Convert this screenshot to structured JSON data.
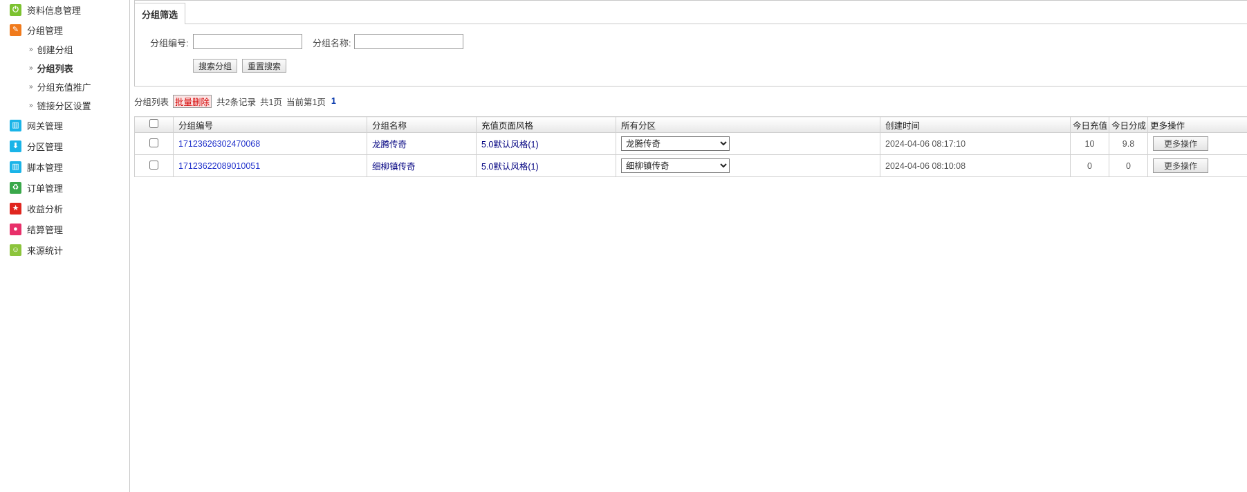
{
  "sidebar": {
    "items": [
      {
        "label": "资料信息管理",
        "icon": "power-icon",
        "color": "#7cc230",
        "glyph": "⏻"
      },
      {
        "label": "分组管理",
        "icon": "pencil-icon",
        "color": "#f07a1c",
        "glyph": "✎"
      },
      {
        "label": "网关管理",
        "icon": "grid-icon",
        "color": "#1ab4e8",
        "glyph": "▥"
      },
      {
        "label": "分区管理",
        "icon": "download-icon",
        "color": "#1ab4e8",
        "glyph": "⬇"
      },
      {
        "label": "脚本管理",
        "icon": "grid-icon",
        "color": "#1ab4e8",
        "glyph": "▥"
      },
      {
        "label": "订单管理",
        "icon": "recycle-icon",
        "color": "#3aa84a",
        "glyph": "♻"
      },
      {
        "label": "收益分析",
        "icon": "star-icon",
        "color": "#e0261f",
        "glyph": "★"
      },
      {
        "label": "结算管理",
        "icon": "record-icon",
        "color": "#e8306a",
        "glyph": "●"
      },
      {
        "label": "来源统计",
        "icon": "smile-icon",
        "color": "#8cc43c",
        "glyph": "☺"
      }
    ],
    "sub_items": [
      {
        "label": "创建分组",
        "active": false
      },
      {
        "label": "分组列表",
        "active": true
      },
      {
        "label": "分组充值推广",
        "active": false
      },
      {
        "label": "链接分区设置",
        "active": false
      }
    ],
    "arrow": "»"
  },
  "filter": {
    "tab": "分组筛选",
    "id_label": "分组编号:",
    "id_value": "",
    "name_label": "分组名称:",
    "name_value": "",
    "search_button": "搜索分组",
    "reset_button": "重置搜索"
  },
  "listbar": {
    "title": "分组列表",
    "batch_delete": "批量删除",
    "total": "共2条记录",
    "pages": "共1页",
    "current": "当前第1页",
    "page_link": "1"
  },
  "table": {
    "headers": [
      "分组编号",
      "分组名称",
      "充值页面风格",
      "所有分区",
      "创建时间",
      "今日充值",
      "今日分成",
      "更多操作"
    ],
    "rows": [
      {
        "id": "17123626302470068",
        "name": "龙腾传奇",
        "style": "5.0默认风格(1)",
        "partition": "龙腾传奇",
        "created": "2024-04-06 08:17:10",
        "recharge": "10",
        "share": "9.8",
        "action": "更多操作"
      },
      {
        "id": "17123622089010051",
        "name": "细柳镇传奇",
        "style": "5.0默认风格(1)",
        "partition": "细柳镇传奇",
        "created": "2024-04-06 08:10:08",
        "recharge": "0",
        "share": "0",
        "action": "更多操作"
      }
    ]
  }
}
